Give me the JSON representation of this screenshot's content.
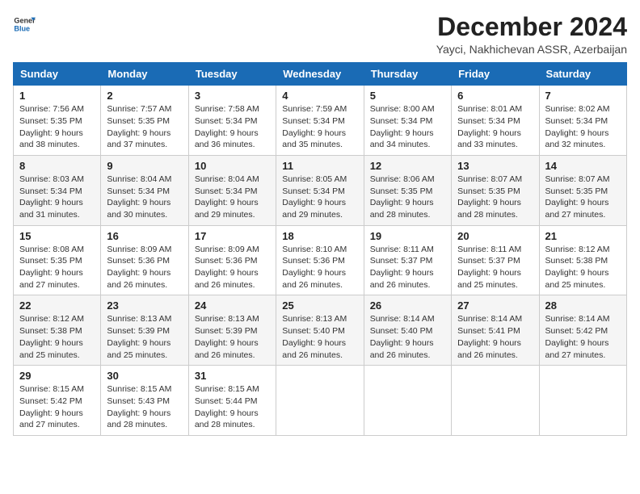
{
  "logo": {
    "general": "General",
    "blue": "Blue"
  },
  "title": "December 2024",
  "subtitle": "Yayci, Nakhichevan ASSR, Azerbaijan",
  "weekdays": [
    "Sunday",
    "Monday",
    "Tuesday",
    "Wednesday",
    "Thursday",
    "Friday",
    "Saturday"
  ],
  "weeks": [
    [
      {
        "day": "1",
        "info": "Sunrise: 7:56 AM\nSunset: 5:35 PM\nDaylight: 9 hours\nand 38 minutes."
      },
      {
        "day": "2",
        "info": "Sunrise: 7:57 AM\nSunset: 5:35 PM\nDaylight: 9 hours\nand 37 minutes."
      },
      {
        "day": "3",
        "info": "Sunrise: 7:58 AM\nSunset: 5:34 PM\nDaylight: 9 hours\nand 36 minutes."
      },
      {
        "day": "4",
        "info": "Sunrise: 7:59 AM\nSunset: 5:34 PM\nDaylight: 9 hours\nand 35 minutes."
      },
      {
        "day": "5",
        "info": "Sunrise: 8:00 AM\nSunset: 5:34 PM\nDaylight: 9 hours\nand 34 minutes."
      },
      {
        "day": "6",
        "info": "Sunrise: 8:01 AM\nSunset: 5:34 PM\nDaylight: 9 hours\nand 33 minutes."
      },
      {
        "day": "7",
        "info": "Sunrise: 8:02 AM\nSunset: 5:34 PM\nDaylight: 9 hours\nand 32 minutes."
      }
    ],
    [
      {
        "day": "8",
        "info": "Sunrise: 8:03 AM\nSunset: 5:34 PM\nDaylight: 9 hours\nand 31 minutes."
      },
      {
        "day": "9",
        "info": "Sunrise: 8:04 AM\nSunset: 5:34 PM\nDaylight: 9 hours\nand 30 minutes."
      },
      {
        "day": "10",
        "info": "Sunrise: 8:04 AM\nSunset: 5:34 PM\nDaylight: 9 hours\nand 29 minutes."
      },
      {
        "day": "11",
        "info": "Sunrise: 8:05 AM\nSunset: 5:34 PM\nDaylight: 9 hours\nand 29 minutes."
      },
      {
        "day": "12",
        "info": "Sunrise: 8:06 AM\nSunset: 5:35 PM\nDaylight: 9 hours\nand 28 minutes."
      },
      {
        "day": "13",
        "info": "Sunrise: 8:07 AM\nSunset: 5:35 PM\nDaylight: 9 hours\nand 28 minutes."
      },
      {
        "day": "14",
        "info": "Sunrise: 8:07 AM\nSunset: 5:35 PM\nDaylight: 9 hours\nand 27 minutes."
      }
    ],
    [
      {
        "day": "15",
        "info": "Sunrise: 8:08 AM\nSunset: 5:35 PM\nDaylight: 9 hours\nand 27 minutes."
      },
      {
        "day": "16",
        "info": "Sunrise: 8:09 AM\nSunset: 5:36 PM\nDaylight: 9 hours\nand 26 minutes."
      },
      {
        "day": "17",
        "info": "Sunrise: 8:09 AM\nSunset: 5:36 PM\nDaylight: 9 hours\nand 26 minutes."
      },
      {
        "day": "18",
        "info": "Sunrise: 8:10 AM\nSunset: 5:36 PM\nDaylight: 9 hours\nand 26 minutes."
      },
      {
        "day": "19",
        "info": "Sunrise: 8:11 AM\nSunset: 5:37 PM\nDaylight: 9 hours\nand 26 minutes."
      },
      {
        "day": "20",
        "info": "Sunrise: 8:11 AM\nSunset: 5:37 PM\nDaylight: 9 hours\nand 25 minutes."
      },
      {
        "day": "21",
        "info": "Sunrise: 8:12 AM\nSunset: 5:38 PM\nDaylight: 9 hours\nand 25 minutes."
      }
    ],
    [
      {
        "day": "22",
        "info": "Sunrise: 8:12 AM\nSunset: 5:38 PM\nDaylight: 9 hours\nand 25 minutes."
      },
      {
        "day": "23",
        "info": "Sunrise: 8:13 AM\nSunset: 5:39 PM\nDaylight: 9 hours\nand 25 minutes."
      },
      {
        "day": "24",
        "info": "Sunrise: 8:13 AM\nSunset: 5:39 PM\nDaylight: 9 hours\nand 26 minutes."
      },
      {
        "day": "25",
        "info": "Sunrise: 8:13 AM\nSunset: 5:40 PM\nDaylight: 9 hours\nand 26 minutes."
      },
      {
        "day": "26",
        "info": "Sunrise: 8:14 AM\nSunset: 5:40 PM\nDaylight: 9 hours\nand 26 minutes."
      },
      {
        "day": "27",
        "info": "Sunrise: 8:14 AM\nSunset: 5:41 PM\nDaylight: 9 hours\nand 26 minutes."
      },
      {
        "day": "28",
        "info": "Sunrise: 8:14 AM\nSunset: 5:42 PM\nDaylight: 9 hours\nand 27 minutes."
      }
    ],
    [
      {
        "day": "29",
        "info": "Sunrise: 8:15 AM\nSunset: 5:42 PM\nDaylight: 9 hours\nand 27 minutes."
      },
      {
        "day": "30",
        "info": "Sunrise: 8:15 AM\nSunset: 5:43 PM\nDaylight: 9 hours\nand 28 minutes."
      },
      {
        "day": "31",
        "info": "Sunrise: 8:15 AM\nSunset: 5:44 PM\nDaylight: 9 hours\nand 28 minutes."
      },
      {
        "day": "",
        "info": ""
      },
      {
        "day": "",
        "info": ""
      },
      {
        "day": "",
        "info": ""
      },
      {
        "day": "",
        "info": ""
      }
    ]
  ]
}
